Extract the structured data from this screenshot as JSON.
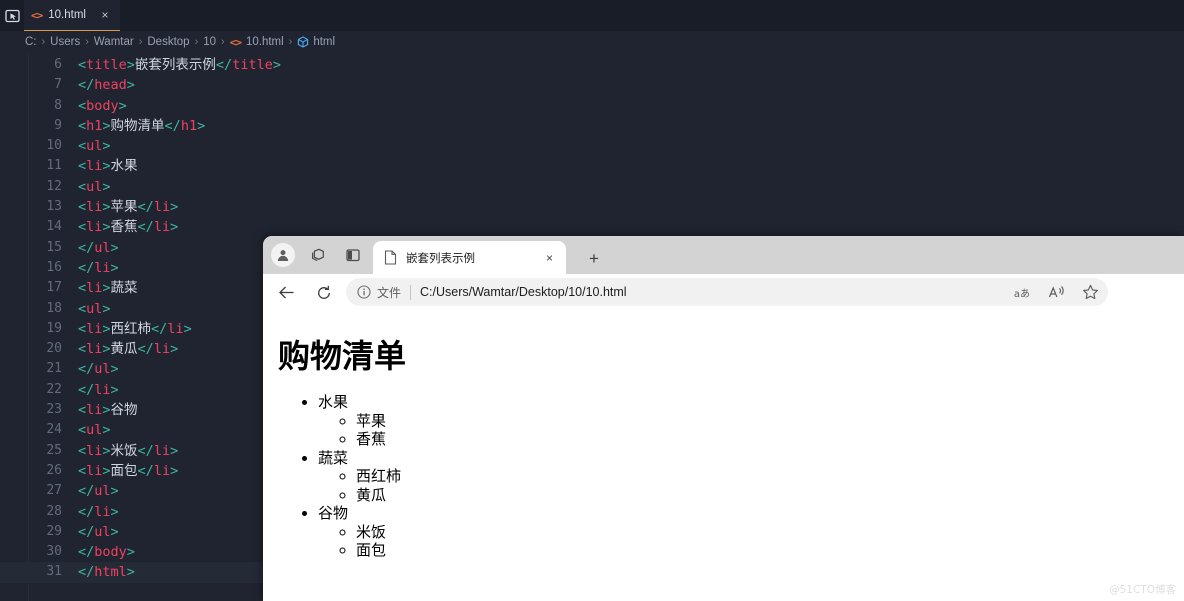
{
  "editor": {
    "activity_icon": "screencast-icon",
    "tab": {
      "icon": "html-file-icon",
      "label": "10.html",
      "close": "×"
    },
    "breadcrumb": {
      "separator": "›",
      "segments": [
        "C:",
        "Users",
        "Wamtar",
        "Desktop",
        "10",
        "10.html",
        "html"
      ],
      "file_icon": "html-file-icon",
      "symbol_icon": "cube-symbol-icon"
    },
    "lines": [
      {
        "n": "6",
        "tokens": [
          [
            "p",
            "<"
          ],
          [
            "t",
            "title"
          ],
          [
            "p",
            ">"
          ],
          [
            "x",
            "嵌套列表示例"
          ],
          [
            "p",
            "</"
          ],
          [
            "t",
            "title"
          ],
          [
            "p",
            ">"
          ]
        ]
      },
      {
        "n": "7",
        "tokens": [
          [
            "p",
            "</"
          ],
          [
            "t",
            "head"
          ],
          [
            "p",
            ">"
          ]
        ]
      },
      {
        "n": "8",
        "tokens": [
          [
            "p",
            "<"
          ],
          [
            "t",
            "body"
          ],
          [
            "p",
            ">"
          ]
        ]
      },
      {
        "n": "9",
        "tokens": [
          [
            "p",
            "<"
          ],
          [
            "t",
            "h1"
          ],
          [
            "p",
            ">"
          ],
          [
            "x",
            "购物清单"
          ],
          [
            "p",
            "</"
          ],
          [
            "t",
            "h1"
          ],
          [
            "p",
            ">"
          ]
        ]
      },
      {
        "n": "10",
        "tokens": [
          [
            "p",
            "<"
          ],
          [
            "t",
            "ul"
          ],
          [
            "p",
            ">"
          ]
        ]
      },
      {
        "n": "11",
        "tokens": [
          [
            "p",
            "<"
          ],
          [
            "t",
            "li"
          ],
          [
            "p",
            ">"
          ],
          [
            "x",
            "水果"
          ]
        ]
      },
      {
        "n": "12",
        "tokens": [
          [
            "p",
            "<"
          ],
          [
            "t",
            "ul"
          ],
          [
            "p",
            ">"
          ]
        ]
      },
      {
        "n": "13",
        "tokens": [
          [
            "p",
            "<"
          ],
          [
            "t",
            "li"
          ],
          [
            "p",
            ">"
          ],
          [
            "x",
            "苹果"
          ],
          [
            "p",
            "</"
          ],
          [
            "t",
            "li"
          ],
          [
            "p",
            ">"
          ]
        ]
      },
      {
        "n": "14",
        "tokens": [
          [
            "p",
            "<"
          ],
          [
            "t",
            "li"
          ],
          [
            "p",
            ">"
          ],
          [
            "x",
            "香蕉"
          ],
          [
            "p",
            "</"
          ],
          [
            "t",
            "li"
          ],
          [
            "p",
            ">"
          ]
        ]
      },
      {
        "n": "15",
        "tokens": [
          [
            "p",
            "</"
          ],
          [
            "t",
            "ul"
          ],
          [
            "p",
            ">"
          ]
        ]
      },
      {
        "n": "16",
        "tokens": [
          [
            "p",
            "</"
          ],
          [
            "t",
            "li"
          ],
          [
            "p",
            ">"
          ]
        ]
      },
      {
        "n": "17",
        "tokens": [
          [
            "p",
            "<"
          ],
          [
            "t",
            "li"
          ],
          [
            "p",
            ">"
          ],
          [
            "x",
            "蔬菜"
          ]
        ]
      },
      {
        "n": "18",
        "tokens": [
          [
            "p",
            "<"
          ],
          [
            "t",
            "ul"
          ],
          [
            "p",
            ">"
          ]
        ]
      },
      {
        "n": "19",
        "tokens": [
          [
            "p",
            "<"
          ],
          [
            "t",
            "li"
          ],
          [
            "p",
            ">"
          ],
          [
            "x",
            "西红柿"
          ],
          [
            "p",
            "</"
          ],
          [
            "t",
            "li"
          ],
          [
            "p",
            ">"
          ]
        ]
      },
      {
        "n": "20",
        "tokens": [
          [
            "p",
            "<"
          ],
          [
            "t",
            "li"
          ],
          [
            "p",
            ">"
          ],
          [
            "x",
            "黄瓜"
          ],
          [
            "p",
            "</"
          ],
          [
            "t",
            "li"
          ],
          [
            "p",
            ">"
          ]
        ]
      },
      {
        "n": "21",
        "tokens": [
          [
            "p",
            "</"
          ],
          [
            "t",
            "ul"
          ],
          [
            "p",
            ">"
          ]
        ]
      },
      {
        "n": "22",
        "tokens": [
          [
            "p",
            "</"
          ],
          [
            "t",
            "li"
          ],
          [
            "p",
            ">"
          ]
        ]
      },
      {
        "n": "23",
        "tokens": [
          [
            "p",
            "<"
          ],
          [
            "t",
            "li"
          ],
          [
            "p",
            ">"
          ],
          [
            "x",
            "谷物"
          ]
        ]
      },
      {
        "n": "24",
        "tokens": [
          [
            "p",
            "<"
          ],
          [
            "t",
            "ul"
          ],
          [
            "p",
            ">"
          ]
        ]
      },
      {
        "n": "25",
        "tokens": [
          [
            "p",
            "<"
          ],
          [
            "t",
            "li"
          ],
          [
            "p",
            ">"
          ],
          [
            "x",
            "米饭"
          ],
          [
            "p",
            "</"
          ],
          [
            "t",
            "li"
          ],
          [
            "p",
            ">"
          ]
        ]
      },
      {
        "n": "26",
        "tokens": [
          [
            "p",
            "<"
          ],
          [
            "t",
            "li"
          ],
          [
            "p",
            ">"
          ],
          [
            "x",
            "面包"
          ],
          [
            "p",
            "</"
          ],
          [
            "t",
            "li"
          ],
          [
            "p",
            ">"
          ]
        ]
      },
      {
        "n": "27",
        "tokens": [
          [
            "p",
            "</"
          ],
          [
            "t",
            "ul"
          ],
          [
            "p",
            ">"
          ]
        ]
      },
      {
        "n": "28",
        "tokens": [
          [
            "p",
            "</"
          ],
          [
            "t",
            "li"
          ],
          [
            "p",
            ">"
          ]
        ]
      },
      {
        "n": "29",
        "tokens": [
          [
            "p",
            "</"
          ],
          [
            "t",
            "ul"
          ],
          [
            "p",
            ">"
          ]
        ]
      },
      {
        "n": "30",
        "tokens": [
          [
            "p",
            "</"
          ],
          [
            "t",
            "body"
          ],
          [
            "p",
            ">"
          ]
        ]
      },
      {
        "n": "31",
        "tokens": [
          [
            "p",
            "</"
          ],
          [
            "t",
            "html"
          ],
          [
            "p",
            ">"
          ]
        ],
        "active": true
      }
    ],
    "colors": {
      "background": "#1f2430",
      "tabstrip": "#191d27",
      "tag": "#f0425f",
      "punctuation": "#3fb5a0",
      "text": "#cfd6e2",
      "line_number": "#636b7b",
      "tab_underline": "#d99a4e",
      "html_icon": "#e8703a"
    }
  },
  "browser": {
    "titlebar_icons": [
      "profile-avatar",
      "collections-icon",
      "split-screen-icon"
    ],
    "tab": {
      "favicon": "page-file-icon",
      "title": "嵌套列表示例",
      "close": "×"
    },
    "new_tab_label": "+",
    "toolbar": {
      "back": "back-arrow-icon",
      "refresh": "refresh-icon",
      "info": "info-circle-icon",
      "scheme_label": "文件",
      "url": "C:/Users/Wamtar/Desktop/10/10.html",
      "right_icons": [
        "translate-icon",
        "read-aloud-icon",
        "favorites-star-icon"
      ],
      "translate_glyph": "aあ"
    },
    "page": {
      "heading": "购物清单",
      "list": [
        {
          "label": "水果",
          "children": [
            "苹果",
            "香蕉"
          ]
        },
        {
          "label": "蔬菜",
          "children": [
            "西红柿",
            "黄瓜"
          ]
        },
        {
          "label": "谷物",
          "children": [
            "米饭",
            "面包"
          ]
        }
      ]
    }
  },
  "watermark": "@51CTO博客"
}
